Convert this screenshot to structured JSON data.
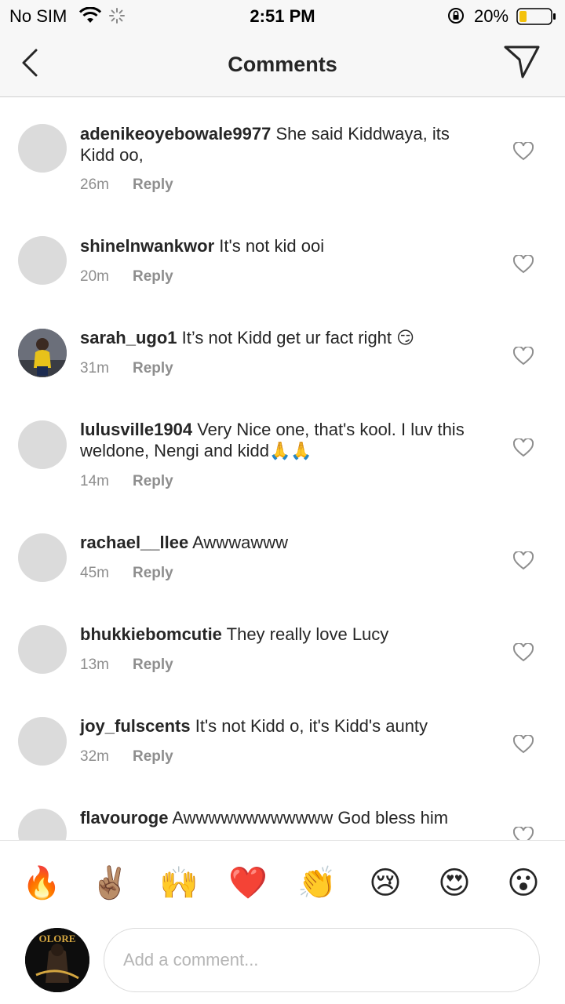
{
  "status_bar": {
    "carrier": "No SIM",
    "time": "2:51 PM",
    "battery": "20%"
  },
  "nav": {
    "title": "Comments"
  },
  "comments": [
    {
      "username": "adenikeoyebowale9977",
      "text": "She said Kiddwaya, its Kidd oo,",
      "time": "26m",
      "reply": "Reply",
      "avatar": "default"
    },
    {
      "username": "shinelnwankwor",
      "text": "It's not kid ooi",
      "time": "20m",
      "reply": "Reply",
      "avatar": "default"
    },
    {
      "username": "sarah_ugo1",
      "text": "It’s not Kidd get ur fact right 😏",
      "time": "31m",
      "reply": "Reply",
      "avatar": "photo"
    },
    {
      "username": "lulusville1904",
      "text": "Very Nice one, that's kool. I luv this weldone, Nengi and kidd🙏🙏",
      "time": "14m",
      "reply": "Reply",
      "avatar": "default"
    },
    {
      "username": "rachael__llee",
      "text": "Awwwawww",
      "time": "45m",
      "reply": "Reply",
      "avatar": "default"
    },
    {
      "username": "bhukkiebomcutie",
      "text": "They really love Lucy",
      "time": "13m",
      "reply": "Reply",
      "avatar": "default"
    },
    {
      "username": "joy_fulscents",
      "text": "It's not Kidd o, it's Kidd's aunty",
      "time": "32m",
      "reply": "Reply",
      "avatar": "default"
    },
    {
      "username": "flavouroge",
      "text": "Awwwwwwwwwwww God bless him",
      "time": "",
      "reply": "",
      "avatar": "default"
    }
  ],
  "emoji_bar": [
    "🔥",
    "✌🏽",
    "🙌",
    "❤️",
    "👏",
    "😢",
    "😍",
    "😮"
  ],
  "composer": {
    "placeholder": "Add a comment...",
    "avatar_text": "OLORE"
  },
  "colors": {
    "text": "#262626",
    "secondary": "#8e8e8e",
    "bar_bg": "#f7f7f7",
    "avatar_placeholder": "#dbdbdb"
  }
}
